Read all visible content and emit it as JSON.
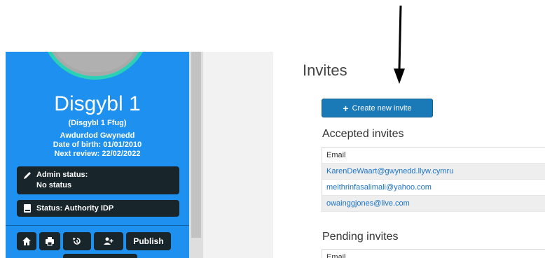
{
  "profile": {
    "name": "Disgybl 1",
    "alias": "(Disgybl 1 Ffug)",
    "authority": "Awdurdod Gwynedd",
    "dob": "Date of birth: 01/01/2010",
    "next_review": "Next review: 22/02/2022",
    "admin_status_label": "Admin status:",
    "admin_status_value": "No status",
    "status": "Status: Authority IDP",
    "publish_label": "Publish"
  },
  "main": {
    "title": "Invites",
    "create_button": "Create new invite",
    "accepted": {
      "heading": "Accepted invites",
      "column_header": "Email",
      "rows": [
        "KarenDeWaart@gwynedd.llyw.cymru",
        "meithrinfasalimali@yahoo.com",
        "owainggjones@live.com"
      ]
    },
    "pending": {
      "heading": "Pending invites",
      "column_header": "Email"
    }
  },
  "colors": {
    "sidebar": "#1e90f0",
    "dark": "#18252b",
    "accent_ring": "#2bd1b6",
    "primary_button": "#1a7ab7",
    "link": "#1a73c8"
  },
  "icons": [
    "pencil-icon",
    "book-icon",
    "home-icon",
    "print-icon",
    "history-icon",
    "add-user-icon",
    "plus-icon",
    "down-arrow"
  ]
}
